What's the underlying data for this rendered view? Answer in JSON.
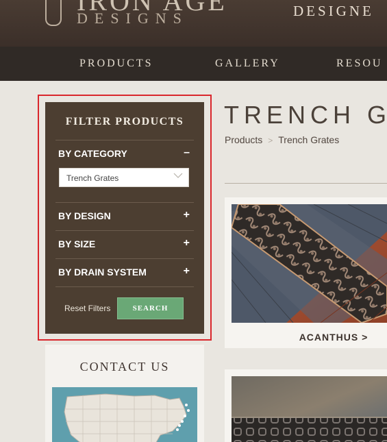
{
  "header": {
    "logo_top": "IRON AGE",
    "logo_bottom": "DESIGNS",
    "tagline": "DESIGNE"
  },
  "nav": {
    "items": [
      {
        "label": "PRODUCTS"
      },
      {
        "label": "GALLERY"
      },
      {
        "label": "RESOU"
      }
    ]
  },
  "filter": {
    "title": "FILTER PRODUCTS",
    "sections": [
      {
        "label": "BY CATEGORY",
        "toggle": "–",
        "expanded": true
      },
      {
        "label": "BY DESIGN",
        "toggle": "+",
        "expanded": false
      },
      {
        "label": "BY SIZE",
        "toggle": "+",
        "expanded": false
      },
      {
        "label": "BY DRAIN SYSTEM",
        "toggle": "+",
        "expanded": false
      }
    ],
    "category_select": {
      "value": "Trench Grates",
      "icon": "chevron-down-icon"
    },
    "reset_label": "Reset Filters",
    "search_label": "SEARCH",
    "highlight_color": "#d9262c",
    "panel_color": "#4c3e31",
    "search_color": "#6aa876"
  },
  "contact": {
    "title": "CONTACT US",
    "map_color": "#5f9fad"
  },
  "main": {
    "page_title": "TRENCH G",
    "breadcrumb": [
      {
        "label": "Products"
      },
      {
        "label": "Trench Grates"
      }
    ],
    "breadcrumb_separator": ">",
    "products": [
      {
        "name": "ACANTHUS >"
      }
    ]
  }
}
